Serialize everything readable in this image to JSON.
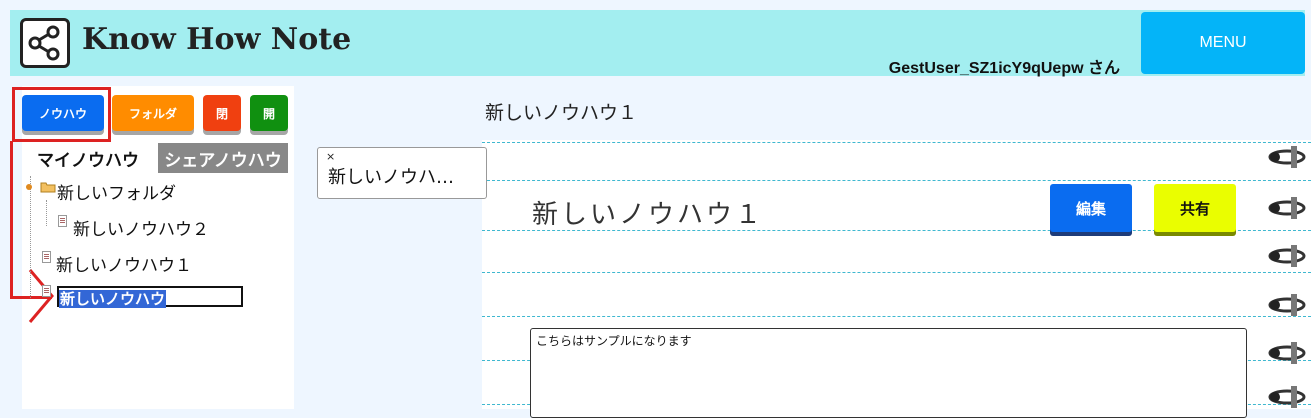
{
  "header": {
    "app_title": "Know How Note",
    "user_label": "GestUser_SZ1icY9qUepw さん",
    "menu_label": "MENU",
    "logo_icon": "share-network-icon"
  },
  "toolbar": {
    "knowhow_label": "ノウハウ",
    "folder_label": "フォルダ",
    "close_label": "閉",
    "open_label": "開",
    "colors": {
      "knowhow": "#0a6cf0",
      "folder": "#ff8c00",
      "close": "#f04010",
      "open": "#109010"
    }
  },
  "tabs": {
    "my_label": "マイノウハウ",
    "share_label": "シェアノウハウ"
  },
  "tree": {
    "folder_label": "新しいフォルダ",
    "child_item": "新しいノウハウ２",
    "item1": "新しいノウハウ１",
    "editing_value": "新しいノウハウ"
  },
  "main": {
    "page_title": "新しいノウハウ１",
    "open_tab_label": "新しいノウハ…",
    "open_tab_close": "×",
    "note_heading": "新しいノウハウ１",
    "edit_label": "編集",
    "share_label": "共有",
    "content_text": "こちらはサンプルになります"
  }
}
